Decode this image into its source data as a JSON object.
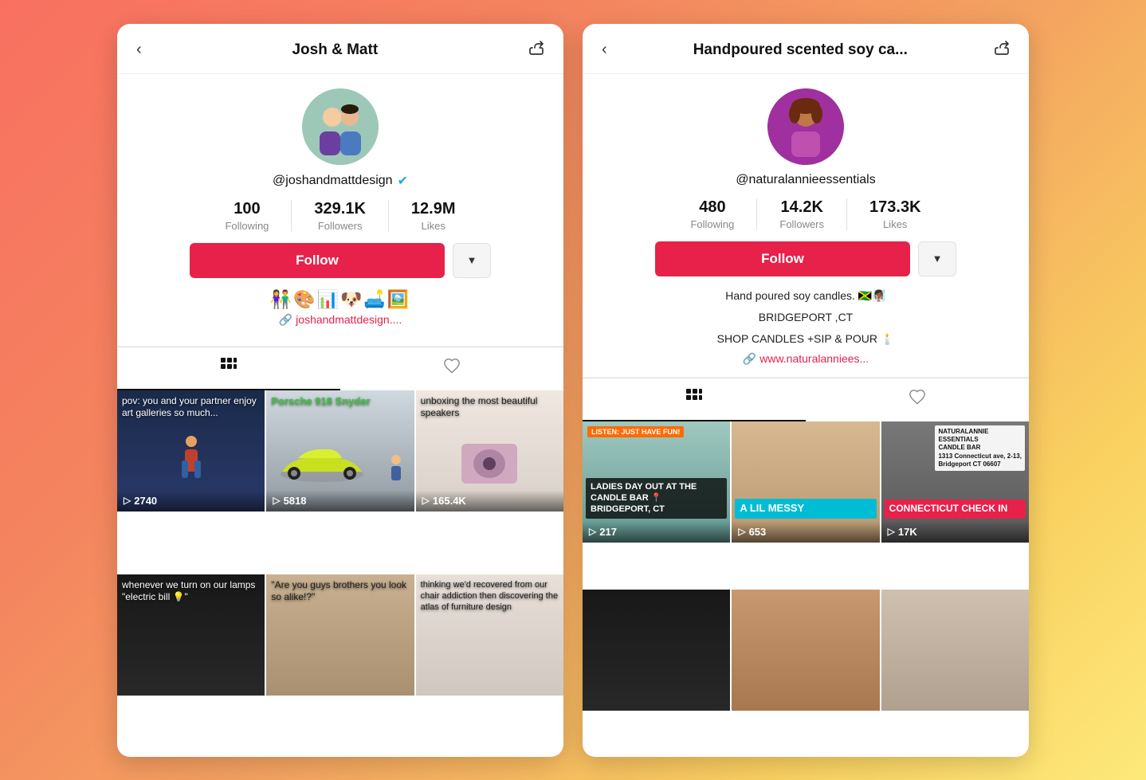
{
  "left": {
    "header": {
      "title": "Josh & Matt",
      "back_icon": "‹",
      "share_icon": "↗"
    },
    "profile": {
      "username": "@joshandmattdesign",
      "verified": true,
      "stats": [
        {
          "number": "100",
          "label": "Following"
        },
        {
          "number": "329.1K",
          "label": "Followers"
        },
        {
          "number": "12.9M",
          "label": "Likes"
        }
      ],
      "follow_label": "Follow",
      "dropdown_icon": "▼",
      "bio_emojis": "👫🎨📊🐶🛋️🖼️",
      "bio_link": "joshandmattdesign....",
      "tab_videos_icon": "⊞",
      "tab_likes_icon": "♡"
    },
    "videos": [
      {
        "bg": "vbg-blue",
        "caption": "pov: you and your partner enjoy art galleries so much...",
        "views": "2740",
        "label": ""
      },
      {
        "bg": "car-cell",
        "caption": "Porsche 918 Snyder",
        "views": "5818",
        "label": ""
      },
      {
        "bg": "speaker-cell",
        "caption": "unboxing the most beautiful speakers",
        "views": "165.4K",
        "label": ""
      },
      {
        "bg": "vbg-dark",
        "caption": "whenever we turn on our lamps \"electric bill 💡\"",
        "views": "",
        "label": ""
      },
      {
        "bg": "vbg-tan",
        "caption": "\"Are you guys brothers you look so alike!?\"",
        "views": "",
        "label": ""
      },
      {
        "bg": "vbg-light",
        "caption": "thinking we'd recovered from our chair addiction then discovering the atlas of furniture design",
        "views": "",
        "label": ""
      }
    ]
  },
  "right": {
    "header": {
      "title": "Handpoured scented soy ca...",
      "back_icon": "‹",
      "share_icon": "↗"
    },
    "profile": {
      "username": "@naturalannieessentials",
      "verified": false,
      "stats": [
        {
          "number": "480",
          "label": "Following"
        },
        {
          "number": "14.2K",
          "label": "Followers"
        },
        {
          "number": "173.3K",
          "label": "Likes"
        }
      ],
      "follow_label": "Follow",
      "dropdown_icon": "▼",
      "bio_line1": "Hand poured soy candles. 🇯🇲🧖🏾‍♀️",
      "bio_line2": "BRIDGEPORT ,CT",
      "bio_line3": "SHOP CANDLES +SIP & POUR 🕯️",
      "bio_link": "www.naturalanniees...",
      "tab_videos_icon": "⊞",
      "tab_likes_icon": "♡"
    },
    "videos": [
      {
        "bg": "vbg-teal",
        "caption": "",
        "views": "217",
        "label": "LADIES DAY OUT AT THE CANDLE BAR 📍 BRIDGEPORT, CT",
        "label_color": "dark",
        "orange_tag": "LISTEN: JUST HAVE FUN!"
      },
      {
        "bg": "vbg-warm",
        "caption": "",
        "views": "653",
        "label": "A LIL MESSY",
        "label_color": "cyan"
      },
      {
        "bg": "vbg-conn",
        "caption": "",
        "views": "17K",
        "label": "CONNECTICUT CHECK IN",
        "label_color": "pink",
        "white_tag": "NATURALANNIE\nESSENTIALS\nCANDLE BAR\n1313 Connecticut ave, 2-13,\nBridgeport CT 06607"
      },
      {
        "bg": "vbg-dark",
        "caption": "",
        "views": "",
        "label": ""
      },
      {
        "bg": "vbg-candle",
        "caption": "",
        "views": "",
        "label": ""
      },
      {
        "bg": "vbg-shop",
        "caption": "",
        "views": "",
        "label": ""
      }
    ]
  }
}
